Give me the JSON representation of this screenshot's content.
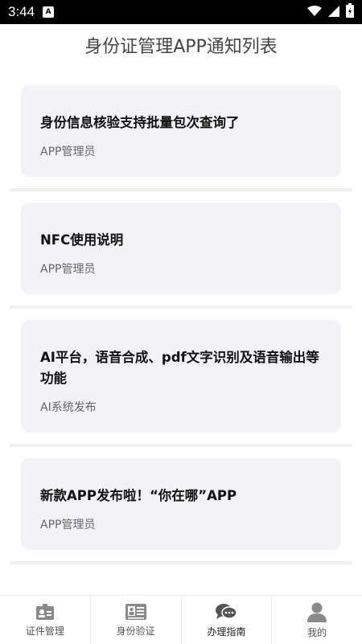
{
  "status_bar": {
    "time": "3:44",
    "app_badge": "A"
  },
  "page": {
    "title": "身份证管理APP通知列表"
  },
  "notifications": [
    {
      "title": "身份信息核验支持批量包次查询了",
      "author": "APP管理员"
    },
    {
      "title": "NFC使用说明",
      "author": "APP管理员"
    },
    {
      "title": "AI平台，语音合成、pdf文字识别及语音输出等功能",
      "author": "AI系统发布"
    },
    {
      "title": "新款APP发布啦！“你在哪”APP",
      "author": "APP管理员"
    }
  ],
  "tabbar": {
    "tabs": [
      {
        "label": "证件管理",
        "icon": "id-card-icon"
      },
      {
        "label": "身份验证",
        "icon": "id-verify-icon"
      },
      {
        "label": "办理指南",
        "icon": "chat-bubbles-icon",
        "active": true
      },
      {
        "label": "我的",
        "icon": "user-icon"
      }
    ]
  },
  "colors": {
    "card_bg": "#f3f3f7",
    "icon_gray": "#8a8a8a",
    "icon_active": "#555555"
  }
}
